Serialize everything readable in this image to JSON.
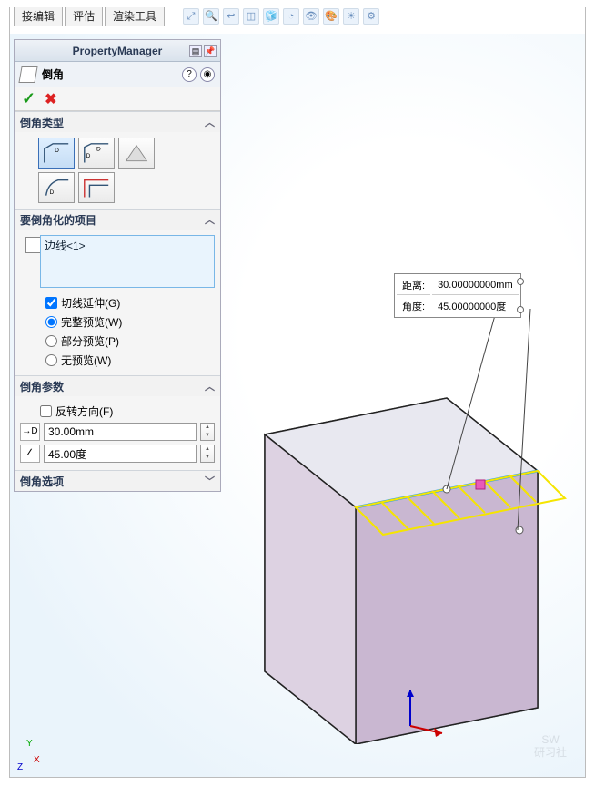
{
  "tabs": {
    "t1": "接编辑",
    "t2": "评估",
    "t3": "渲染工具"
  },
  "pm": {
    "title": "PropertyManager",
    "feature_label": "倒角",
    "help_glyph": "?",
    "detail_glyph": "◉",
    "ok_glyph": "✓",
    "cancel_glyph": "✖"
  },
  "section_type": {
    "title": "倒角类型"
  },
  "section_items": {
    "title": "要倒角化的项目",
    "entry1": "边线<1>",
    "tangent_label": "切线延伸(G)",
    "preview_full": "完整预览(W)",
    "preview_partial": "部分预览(P)",
    "preview_none": "无预览(W)"
  },
  "section_params": {
    "title": "倒角参数",
    "flip_label": "反转方向(F)",
    "distance_value": "30.00mm",
    "angle_value": "45.00度"
  },
  "section_options": {
    "title": "倒角选项"
  },
  "callout": {
    "dist_label": "距离:",
    "dist_value": "30.00000000mm",
    "ang_label": "角度:",
    "ang_value": "45.00000000度"
  },
  "watermark": {
    "line1": "SW",
    "line2": "研习社"
  }
}
